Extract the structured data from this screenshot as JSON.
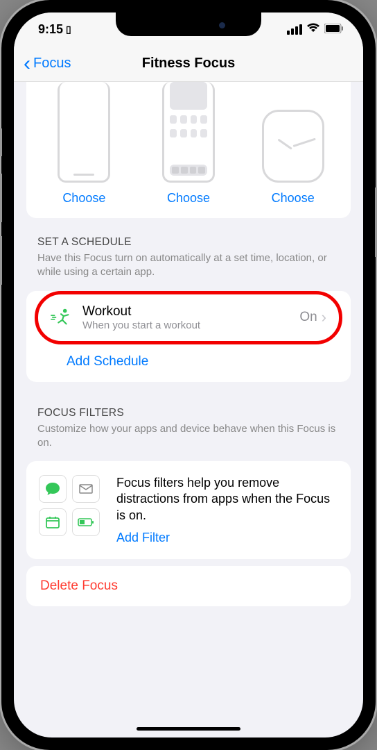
{
  "status": {
    "time": "9:15",
    "signal_strength": 4,
    "battery": "full"
  },
  "header": {
    "back_label": "Focus",
    "title": "Fitness Focus"
  },
  "previews": {
    "lock_choose": "Choose",
    "home_choose": "Choose",
    "watch_choose": "Choose"
  },
  "schedule": {
    "header": "SET A SCHEDULE",
    "desc": "Have this Focus turn on automatically at a set time, location, or while using a certain app.",
    "workout": {
      "title": "Workout",
      "subtitle": "When you start a workout",
      "status": "On"
    },
    "add_label": "Add Schedule"
  },
  "filters": {
    "header": "FOCUS FILTERS",
    "desc": "Customize how your apps and device behave when this Focus is on.",
    "body_text": "Focus filters help you remove distractions from apps when the Focus is on.",
    "add_label": "Add Filter"
  },
  "delete_label": "Delete Focus"
}
